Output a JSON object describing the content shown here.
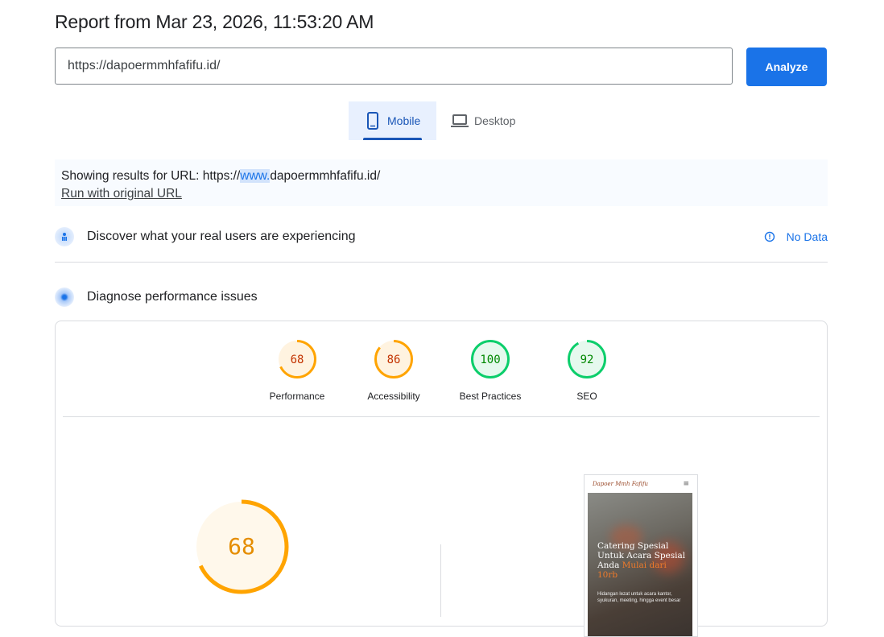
{
  "header": {
    "title": "Report from Mar 23, 2026, 11:53:20 AM"
  },
  "search": {
    "url_value": "https://dapoermmhfafifu.id/",
    "analyze_label": "Analyze"
  },
  "tabs": [
    {
      "label": "Mobile",
      "icon": "mobile-icon",
      "active": true
    },
    {
      "label": "Desktop",
      "icon": "laptop-icon",
      "active": false
    }
  ],
  "notice": {
    "prefix": "Showing results for URL: https://",
    "highlight": "www.",
    "suffix": "dapoermmhfafifu.id/",
    "run_link": "Run with original URL"
  },
  "field_data": {
    "title": "Discover what your real users are experiencing",
    "no_data": "No Data"
  },
  "lab_data": {
    "title": "Diagnose performance issues"
  },
  "scores": [
    {
      "key": "performance",
      "value": "68",
      "label": "Performance",
      "color": "#ffa400",
      "text_color": "#c33300",
      "fill": "#fff3e0"
    },
    {
      "key": "accessibility",
      "value": "86",
      "label": "Accessibility",
      "color": "#ffa400",
      "text_color": "#c33300",
      "fill": "#fff3e0"
    },
    {
      "key": "best-practices",
      "value": "100",
      "label": "Best Practices",
      "color": "#0cce6b",
      "text_color": "#008800",
      "fill": "#e6f9ee"
    },
    {
      "key": "seo",
      "value": "92",
      "label": "SEO",
      "color": "#0cce6b",
      "text_color": "#008800",
      "fill": "#e6f9ee"
    }
  ],
  "big_score": {
    "value": "68",
    "color": "#ffa400",
    "fill": "#fff8eb"
  },
  "screenshot": {
    "site_name": "Dapoer Mmh Fafifu",
    "hero_title_main": "Catering Spesial Untuk Acara Spesial Anda",
    "hero_title_accent": "Mulai dari 10rb",
    "hero_subtitle": "Hidangan lezat untuk acara kantor, syukuran, meeting, hingga event besar"
  }
}
